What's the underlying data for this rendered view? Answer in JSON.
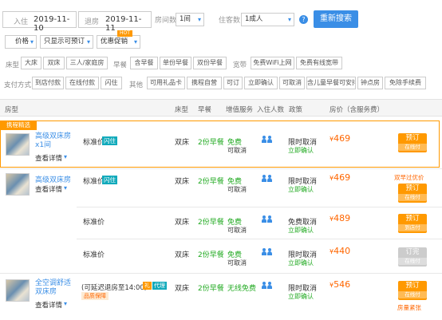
{
  "search": {
    "checkin_label": "入住",
    "checkin": "2019-11-10",
    "checkout_label": "退房",
    "checkout": "2019-11-11",
    "rooms_label": "房间数",
    "rooms": "1间",
    "guests_label": "住客数",
    "guests": "1成人",
    "search_button": "重新搜索"
  },
  "sort": {
    "price": "价格",
    "only_available": "只显示可预订",
    "preferential": "优惠促销",
    "hot": "HOT"
  },
  "filters": {
    "bed_label": "床型",
    "bed": [
      "大床",
      "双床",
      "三人/家庭房"
    ],
    "breakfast_label": "早餐",
    "breakfast": [
      "含早餐",
      "单份早餐",
      "双份早餐"
    ],
    "wifi_label": "宽带",
    "wifi": [
      "免费WiFi上网",
      "免费有线宽带"
    ],
    "pay_label": "支付方式",
    "pay": [
      "到店付款",
      "在线付款",
      "闪住"
    ],
    "other_label": "其他",
    "other": [
      "可用礼品卡",
      "携程自营",
      "可订",
      "立即确认",
      "可取消",
      "含儿童早餐可安排",
      "钟点房",
      "免除手续费"
    ]
  },
  "table_header": {
    "room": "房型",
    "bed": "床型",
    "breakfast": "早餐",
    "extras": "增值服务",
    "occupancy": "入住人数",
    "policy": "政策",
    "price": "房价（含服务费）"
  },
  "rows": [
    {
      "promo": "携程精选",
      "room_name": "高级双床房x1间",
      "details": "查看详情",
      "plan": "标准价",
      "plan_badge": "闪住",
      "bed": "双床",
      "breakfast": "2份早餐",
      "extra1": "免费",
      "extra2": "可取消",
      "policy1": "限时取消",
      "policy2": "立即确认",
      "price": "469",
      "book": "预订",
      "book_sub": "在线付",
      "note": ""
    },
    {
      "promo": "",
      "room_name": "高级双床房",
      "details": "查看详情",
      "plan": "标准价",
      "plan_badge": "闪住",
      "bed": "双床",
      "breakfast": "2份早餐",
      "extra1": "免费",
      "extra2": "可取消",
      "policy1": "限时取消",
      "policy2": "立即确认",
      "price": "469",
      "book": "预订",
      "book_sub": "在线付",
      "note": "双早过优价",
      "book_b": "预订",
      "book_b_sub": "到店付"
    },
    {
      "plan": "标准价",
      "bed": "双床",
      "breakfast": "2份早餐",
      "extra1": "免费",
      "extra2": "可取消",
      "policy1": "免费取消",
      "policy2": "立即确认",
      "price": "489",
      "book": "预订",
      "book_sub": "到店付"
    },
    {
      "plan": "标准价",
      "bed": "双床",
      "breakfast": "2份早餐",
      "extra1": "免费",
      "extra2": "可取消",
      "policy1": "限时取消",
      "policy2": "立即确认",
      "price": "440",
      "book": "订完",
      "book_sub": "在线付"
    },
    {
      "room_name": "全空调舒适双床房",
      "details": "查看详情",
      "plan": "(可延迟退房至14:00)",
      "plan_badges": [
        "礼",
        "代理"
      ],
      "plan_sub": "品质保障",
      "bed": "双床",
      "breakfast": "2份早餐",
      "extra1": "无线免费",
      "policy1": "限时取消",
      "policy2": "立即确认",
      "price": "546",
      "book": "预订",
      "book_sub": "在线付",
      "note": "房量紧张"
    }
  ]
}
